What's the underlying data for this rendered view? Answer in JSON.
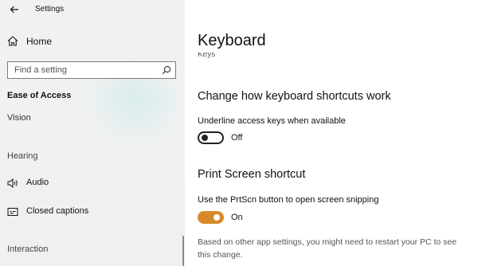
{
  "window": {
    "title": "Settings"
  },
  "sidebar": {
    "home_label": "Home",
    "search_placeholder": "Find a setting",
    "section_label": "Ease of Access",
    "cut_item": "Vision",
    "groups": [
      {
        "label": "Hearing"
      },
      {
        "label": "Interaction"
      }
    ],
    "items": [
      {
        "label": "Audio",
        "icon": "speaker-icon"
      },
      {
        "label": "Closed captions",
        "icon": "closed-captions-icon"
      }
    ]
  },
  "main": {
    "page_title": "Keyboard",
    "cut_text": "Keys",
    "sections": [
      {
        "heading": "Change how keyboard shortcuts work",
        "setting_label": "Underline access keys when available",
        "toggle_state": "Off",
        "toggle_on": false
      },
      {
        "heading": "Print Screen shortcut",
        "setting_label": "Use the PrtScn button to open screen snipping",
        "toggle_state": "On",
        "toggle_on": true
      }
    ],
    "note": "Based on other app settings, you might need to restart your PC to see this change."
  },
  "colors": {
    "accent": "#d78a2a",
    "sidebar_bg": "#f0f2f2"
  }
}
